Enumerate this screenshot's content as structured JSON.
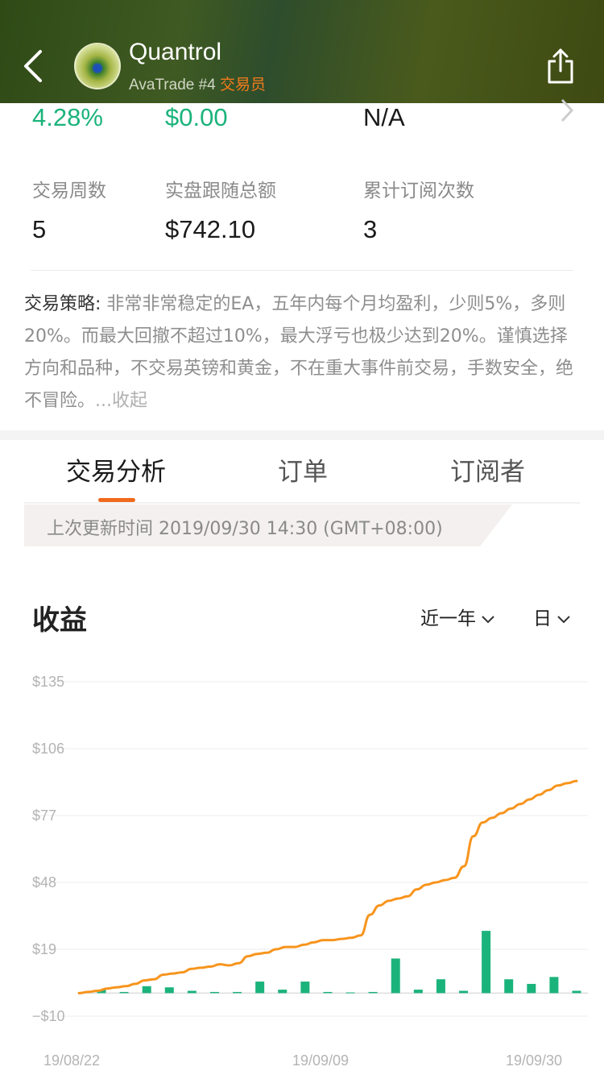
{
  "header": {
    "trader_name": "Quantrol",
    "broker_rank": "AvaTrade #4",
    "role": "交易员"
  },
  "stats_top": [
    {
      "value": "4.28%",
      "color": "#1bb37c"
    },
    {
      "value": "$0.00",
      "color": "#1bb37c"
    },
    {
      "value": "N/A",
      "color": "#1a1a1a"
    }
  ],
  "stats": [
    {
      "label": "交易周数",
      "value": "5"
    },
    {
      "label": "实盘跟随总额",
      "value": "$742.10"
    },
    {
      "label": "累计订阅次数",
      "value": "3"
    }
  ],
  "strategy": {
    "key": "交易策略:",
    "text": " 非常非常稳定的EA，五年内每个月均盈利，少则5%，多则20%。而最大回撤不超过10%，最大浮亏也极少达到20%。谨慎选择方向和品种，不交易英镑和黄金，不在重大事件前交易，手数安全，绝不冒险。",
    "collapse": "...收起"
  },
  "tabs": [
    {
      "label": "交易分析",
      "active": true
    },
    {
      "label": "订单",
      "active": false
    },
    {
      "label": "订阅者",
      "active": false
    }
  ],
  "update": {
    "text": "上次更新时间 2019/09/30 14:30 (GMT+08:00)"
  },
  "profit_section": {
    "title": "收益",
    "period_select": "近一年",
    "interval_select": "日"
  },
  "colors": {
    "accent": "#f06a1c",
    "line": "#f7941d",
    "bar": "#1bb37c",
    "green_text": "#1bb37c"
  },
  "chart_data": {
    "type": "line",
    "y_tick_labels": [
      "$135",
      "$106",
      "$77",
      "$48",
      "$19",
      "−$10"
    ],
    "y_ticks": [
      135,
      106,
      77,
      48,
      19,
      -10
    ],
    "ylim": [
      -10,
      135
    ],
    "x_tick_labels": [
      "19/08/22",
      "19/09/09",
      "19/09/30"
    ],
    "grid": true,
    "series": [
      {
        "kind": "line",
        "values": [
          0,
          0.5,
          1,
          2,
          2.5,
          3,
          4,
          5.5,
          6,
          8,
          8.5,
          9,
          10.5,
          11,
          11.5,
          12.5,
          12,
          13,
          16,
          17,
          17.5,
          19,
          20,
          20,
          21,
          22,
          23,
          23,
          23.5,
          24,
          25,
          34,
          38,
          40,
          41,
          42,
          45,
          47,
          48,
          49,
          50,
          55,
          68,
          74,
          76,
          78,
          80,
          82,
          84,
          86,
          88,
          90,
          91,
          92
        ]
      },
      {
        "kind": "bar",
        "values": [
          1.5,
          0.5,
          3,
          2.5,
          1,
          0.5,
          0.5,
          5,
          1.5,
          5,
          0.5,
          0.3,
          0.5,
          15,
          1.5,
          6,
          1,
          27,
          6,
          4,
          7,
          1
        ]
      }
    ]
  }
}
